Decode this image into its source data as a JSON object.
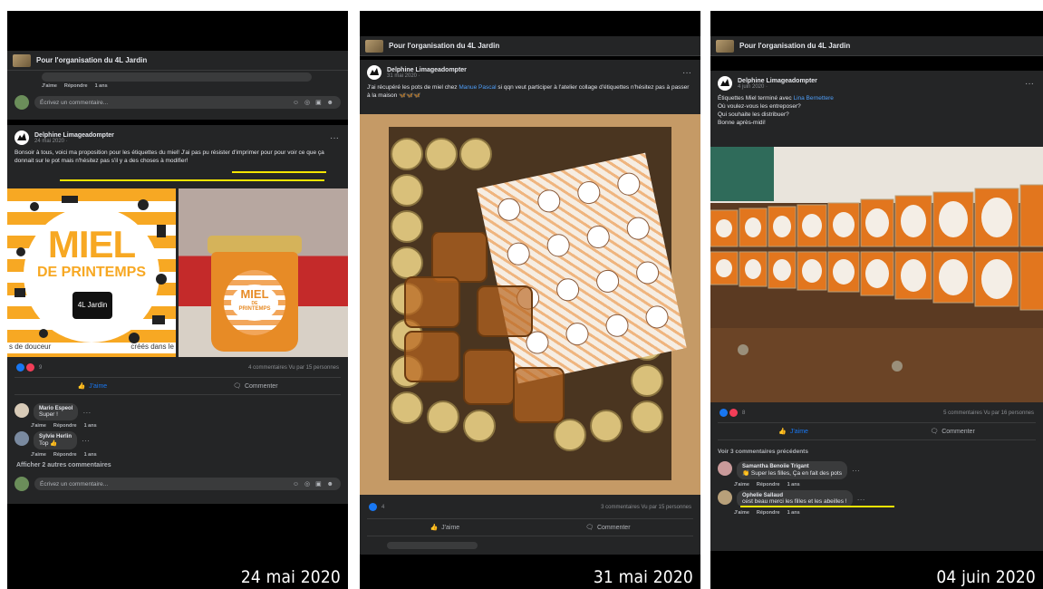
{
  "panels": [
    {
      "date": "24 mai 2020",
      "group_name": "Pour l'organisation du 4L Jardin",
      "prev_comment_actions": [
        "J'aime",
        "Répondre",
        "1 ans"
      ],
      "comment_placeholder": "Écrivez un commentaire...",
      "post": {
        "author": "Delphine Limageadompter",
        "time": "24 mai 2020 · ",
        "text": "Bonsoir à tous, voici ma proposition pour les étiquettes du miel! J'ai pas pu résister d'imprimer pour pour voir ce que ça donnait sur le pot mais n'hésitez pas s'il y a des choses à modifier!",
        "label_title_1": "MIEL",
        "label_title_2": "DE PRINTEMPS",
        "label_brand": "4L Jardin",
        "label_footer_left": "s de douceur",
        "label_footer_right": "créés dans le",
        "jar_label_1": "MIEL",
        "jar_label_2": "DE",
        "jar_label_3": "PRINTEMPS",
        "reactions_count": "9",
        "stats": "4 commentaires  Vu par 15 personnes",
        "like_label": "J'aime",
        "comment_label": "Commenter",
        "comments": [
          {
            "name": "Mario Espeol",
            "text": "Super !"
          },
          {
            "name": "Sylvie Herlin",
            "text": "Top 👍"
          }
        ],
        "comment_actions": [
          "J'aime",
          "Répondre",
          "1 ans"
        ],
        "more_comments": "Afficher 2 autres commentaires"
      }
    },
    {
      "date": "31 mai 2020",
      "group_name": "Pour l'organisation du 4L Jardin",
      "post": {
        "author": "Delphine Limageadompter",
        "time": "31 mai 2020 · ",
        "text": "J'ai récupéré les pots de miel chez ",
        "text_link": "Manue Pascal",
        "text_rest": " si qqn veut participer à l'atelier collage d'étiquettes n'hésitez pas à passer à la maison 🦋🦋🦋",
        "reactions_count": "4",
        "stats": "3 commentaires  Vu par 15 personnes",
        "like_label": "J'aime",
        "comment_label": "Commenter"
      }
    },
    {
      "date": "04 juin 2020",
      "group_name": "Pour l'organisation du 4L Jardin",
      "post": {
        "author": "Delphine Limageadompter",
        "time": "4 juin 2020 · ",
        "text_lines": [
          "Étiquettes Miel terminé avec ",
          "Où voulez-vous les entreposer?",
          "Qui souhaite les distribuer?",
          "Bonne après-midi!"
        ],
        "text_link": "Lina Bernettere",
        "reactions_count": "8",
        "stats": "5 commentaires  Vu par 16 personnes",
        "like_label": "J'aime",
        "comment_label": "Commenter",
        "prev_comments": "Voir 3 commentaires précédents",
        "comments": [
          {
            "name": "Samantha Benoiie Trigant",
            "text": "👏 Super les filles, Ça en fait des pots"
          },
          {
            "name": "Ophelie Sallaud",
            "text": "cest beau merci les filles et les abeilles !"
          }
        ],
        "comment_actions": [
          "J'aime",
          "Répondre",
          "1 ans"
        ]
      }
    }
  ],
  "colors": {
    "card_bg": "#242526",
    "text": "#e4e6eb",
    "muted": "#8a8d91",
    "accent_blue": "#1877f2",
    "highlight_yellow": "#f4e400",
    "label_orange": "#f5a623"
  }
}
